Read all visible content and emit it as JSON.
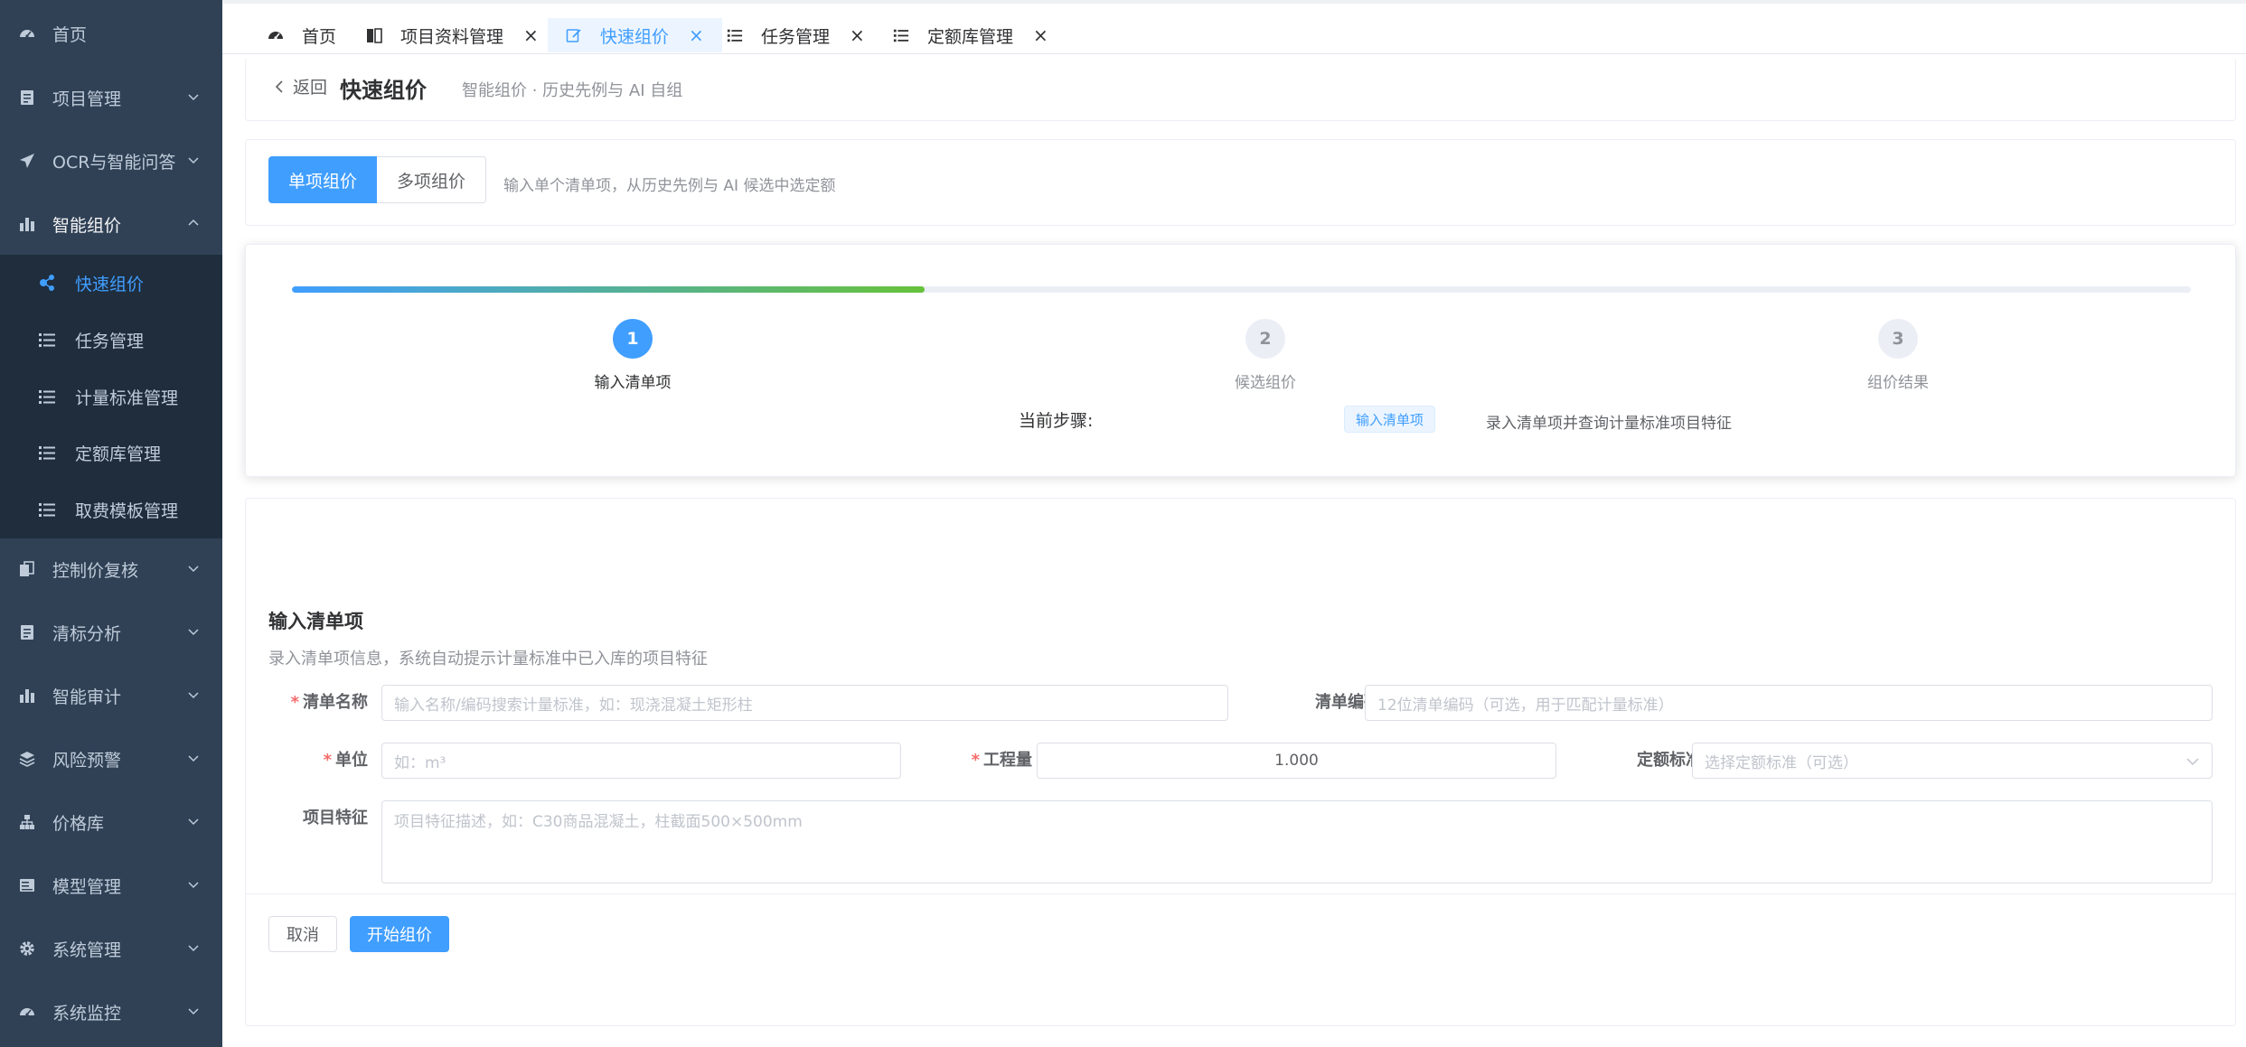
{
  "sidebar": {
    "items": [
      {
        "label": "首页",
        "icon": "dashboard-icon"
      },
      {
        "label": "项目管理",
        "icon": "document-icon"
      },
      {
        "label": "OCR与智能问答",
        "icon": "paper-plane-icon"
      },
      {
        "label": "智能组价",
        "icon": "bar-chart-icon"
      },
      {
        "label": "控制价复核",
        "icon": "copy-icon"
      },
      {
        "label": "清标分析",
        "icon": "document-icon"
      },
      {
        "label": "智能审计",
        "icon": "bar-chart-icon"
      },
      {
        "label": "风险预警",
        "icon": "layers-icon"
      },
      {
        "label": "价格库",
        "icon": "hierarchy-icon"
      },
      {
        "label": "模型管理",
        "icon": "server-icon"
      },
      {
        "label": "系统管理",
        "icon": "gear-icon"
      },
      {
        "label": "系统监控",
        "icon": "dashboard-icon"
      }
    ],
    "submenu": [
      {
        "label": "快速组价",
        "icon": "share-nodes-icon"
      },
      {
        "label": "任务管理",
        "icon": "list-icon"
      },
      {
        "label": "计量标准管理",
        "icon": "list-icon"
      },
      {
        "label": "定额库管理",
        "icon": "list-icon"
      },
      {
        "label": "取费模板管理",
        "icon": "list-icon"
      }
    ]
  },
  "tags": [
    {
      "label": "首页",
      "closable": false
    },
    {
      "label": "项目资料管理",
      "closable": true
    },
    {
      "label": "快速组价",
      "closable": true,
      "active": true
    },
    {
      "label": "任务管理",
      "closable": true
    },
    {
      "label": "定额库管理",
      "closable": true
    }
  ],
  "tag_close": "×",
  "header": {
    "back_label": "返回",
    "title": "快速组价",
    "subtitle": "智能组价 · 历史先例与 AI 自组"
  },
  "mode": {
    "single_label": "单项组价",
    "multi_label": "多项组价",
    "hint": "输入单个清单项，从历史先例与 AI 候选中选定额"
  },
  "steps": {
    "progress": 0.333,
    "items": [
      {
        "num": "1",
        "label": "输入清单项"
      },
      {
        "num": "2",
        "label": "候选组价"
      },
      {
        "num": "3",
        "label": "组价结果"
      }
    ],
    "current_label": "当前步骤:",
    "current_badge": "输入清单项",
    "current_desc": "录入清单项并查询计量标准项目特征"
  },
  "form": {
    "title": "输入清单项",
    "desc": "录入清单项信息，系统自动提示计量标准中已入库的项目特征",
    "required_mark": "*",
    "name_label": "清单名称",
    "name_placeholder": "输入名称/编码搜索计量标准，如：现浇混凝土矩形柱",
    "code_label": "清单编码",
    "code_placeholder": "12位清单编码（可选，用于匹配计量标准）",
    "unit_label": "单位",
    "unit_placeholder": "如：m³",
    "qty_label": "工程量",
    "qty_value": "1.000",
    "quota_label": "定额标准",
    "quota_placeholder": "选择定额标准（可选）",
    "feature_label": "项目特征",
    "feature_placeholder": "项目特征描述，如：C30商品混凝土，柱截面500×500mm",
    "cancel_label": "取消",
    "submit_label": "开始组价"
  },
  "colors": {
    "sidebar_bg": "#304156",
    "submenu_bg": "#1f2d3d",
    "primary": "#409eff",
    "success": "#67c23a",
    "required": "#f56c6c"
  }
}
